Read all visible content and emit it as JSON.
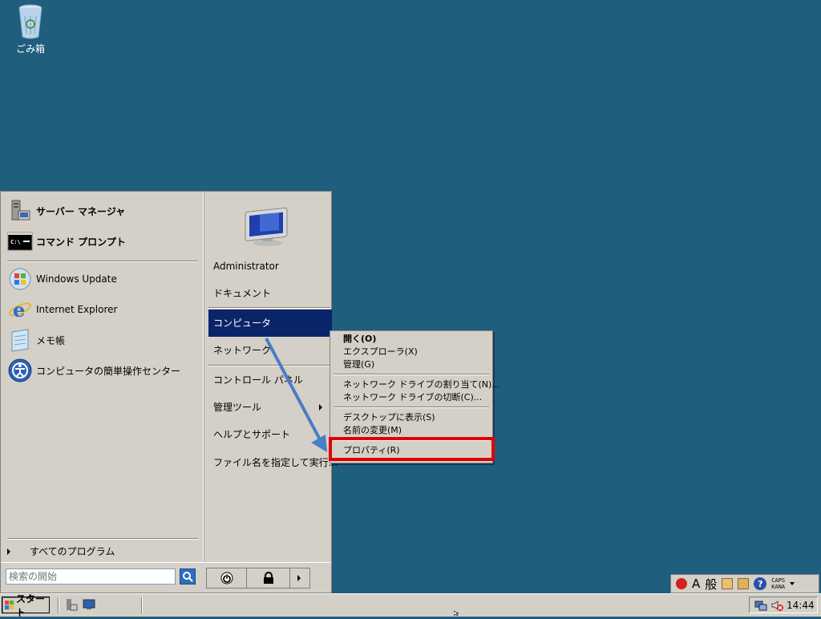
{
  "desktop": {
    "recycle_bin_label": "ごみ箱"
  },
  "start_menu": {
    "pinned": [
      {
        "label": "サーバー マネージャ",
        "icon": "server-manager-icon"
      },
      {
        "label": "コマンド プロンプト",
        "icon": "command-prompt-icon"
      }
    ],
    "recent": [
      {
        "label": "Windows Update",
        "icon": "windows-update-icon"
      },
      {
        "label": "Internet Explorer",
        "icon": "internet-explorer-icon"
      },
      {
        "label": "メモ帳",
        "icon": "notepad-icon"
      },
      {
        "label": "コンピュータの簡単操作センター",
        "icon": "ease-of-access-icon"
      }
    ],
    "all_programs": "すべてのプログラム",
    "search_placeholder": "検索の開始",
    "right": {
      "user": "Administrator",
      "documents": "ドキュメント",
      "computer": "コンピュータ",
      "network": "ネットワーク",
      "control_panel": "コントロール パネル",
      "admin_tools": "管理ツール",
      "help": "ヘルプとサポート",
      "run": "ファイル名を指定して実行..."
    }
  },
  "context_menu": {
    "open": "開く(O)",
    "explorer": "エクスプローラ(X)",
    "manage": "管理(G)",
    "map_drive": "ネットワーク ドライブの割り当て(N)...",
    "disconnect_drive": "ネットワーク ドライブの切断(C)...",
    "show_on_desktop": "デスクトップに表示(S)",
    "rename": "名前の変更(M)",
    "properties": "プロパティ(R)"
  },
  "ime": {
    "mode": "A",
    "kanji": "般",
    "caps": "CAPS",
    "kana": "KANA"
  },
  "taskbar": {
    "start_label": "スタート",
    "clock": "14:44"
  },
  "colors": {
    "desktop": "#1f5e7d",
    "highlight": "#0a246a",
    "annotation_red": "#e00000",
    "annotation_arrow": "#4a7ec4"
  }
}
